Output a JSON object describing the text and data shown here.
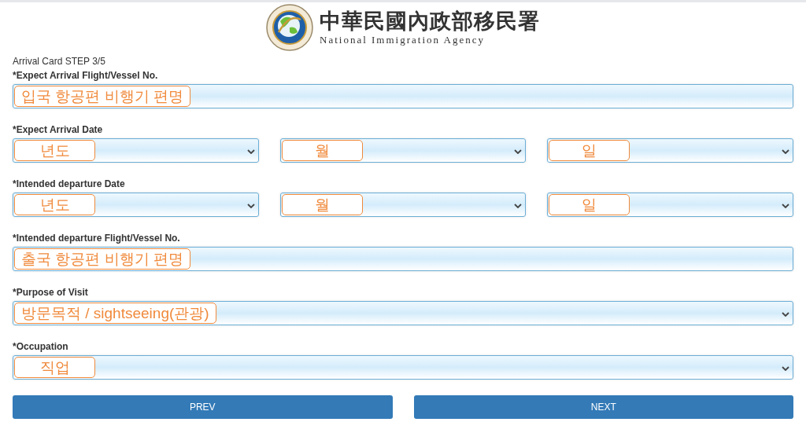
{
  "header": {
    "title": "中華民國內政部移民署",
    "subtitle": "National Immigration Agency"
  },
  "step": "Arrival Card STEP 3/5",
  "fields": [
    {
      "kind": "text",
      "label": "*Expect Arrival Flight/Vessel No.",
      "annotation": "입국 항공편 비행기 편명"
    },
    {
      "kind": "date",
      "label": "*Expect Arrival Date",
      "parts": [
        {
          "annotation": "년도"
        },
        {
          "annotation": "월"
        },
        {
          "annotation": "일"
        }
      ]
    },
    {
      "kind": "date",
      "label": "*Intended departure Date",
      "parts": [
        {
          "annotation": "년도"
        },
        {
          "annotation": "월"
        },
        {
          "annotation": "일"
        }
      ]
    },
    {
      "kind": "text",
      "label": "*Intended departure Flight/Vessel No.",
      "annotation": "출국 항공편 비행기 편명"
    },
    {
      "kind": "select",
      "label": "*Purpose of Visit",
      "annotation": "방문목적 / sightseeing(관광)"
    },
    {
      "kind": "select",
      "label": "*Occupation",
      "annotation": "직업"
    }
  ],
  "buttons": [
    "PREV",
    "NEXT"
  ]
}
